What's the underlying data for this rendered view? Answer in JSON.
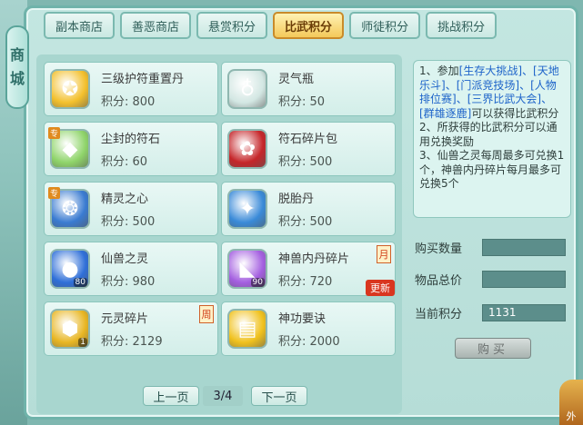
{
  "side_tab": {
    "label_1": "商",
    "label_2": "城"
  },
  "tabs": [
    {
      "label": "副本商店"
    },
    {
      "label": "善恶商店"
    },
    {
      "label": "悬赏积分"
    },
    {
      "label": "比武积分",
      "active": true
    },
    {
      "label": "师徒积分"
    },
    {
      "label": "挑战积分"
    }
  ],
  "items": [
    {
      "name": "三级护符重置丹",
      "price": "积分: 800",
      "icon": "coin-amulet-icon",
      "color": "#f3c02d"
    },
    {
      "name": "灵气瓶",
      "price": "积分: 50",
      "icon": "bottle-icon",
      "color": "#d3e7e3"
    },
    {
      "name": "尘封的符石",
      "price": "积分: 60",
      "icon": "gem-stone-icon",
      "color": "#8fd46a",
      "zhuan": "专"
    },
    {
      "name": "符石碎片包",
      "price": "积分: 500",
      "icon": "bag-icon",
      "color": "#c5262a"
    },
    {
      "name": "精灵之心",
      "price": "积分: 500",
      "icon": "spirit-heart-icon",
      "color": "#3a7bd1",
      "zhuan": "专"
    },
    {
      "name": "脱胎丹",
      "price": "积分: 500",
      "icon": "pill-icon",
      "color": "#3a8ad8"
    },
    {
      "name": "仙兽之灵",
      "price": "积分: 980",
      "icon": "orb-icon",
      "color": "#2f6fd8",
      "count": "80"
    },
    {
      "name": "神兽内丹碎片",
      "price": "积分: 720",
      "icon": "crystal-shard-icon",
      "color": "#a45fe0",
      "count": "90",
      "cycle": "月",
      "new_tag": "更新"
    },
    {
      "name": "元灵碎片",
      "price": "积分: 2129",
      "icon": "gold-fragment-icon",
      "color": "#e8b623",
      "count": "1",
      "cycle": "周"
    },
    {
      "name": "神功要诀",
      "price": "积分: 2000",
      "icon": "book-icon",
      "color": "#f0c11d"
    }
  ],
  "description": {
    "p1_prefix": "1、参加",
    "p1_links": [
      "[生存大挑战]",
      "、[天地乐斗]",
      "、[门派竞技场]",
      "、[人物排位赛]",
      "、[三界比武大会]",
      "、[群雄逐鹿]"
    ],
    "p1_suffix": "可以获得比武积分",
    "p2": "2、所获得的比武积分可以通用兑换奖励",
    "p3": "3、仙兽之灵每周最多可兑换1个，神兽内丹碎片每月最多可兑换5个"
  },
  "form": {
    "qty_label": "购买数量",
    "qty_value": "",
    "total_label": "物品总价",
    "total_value": "",
    "points_label": "当前积分",
    "points_value": "1131",
    "buy_label": "购买"
  },
  "pager": {
    "prev": "上一页",
    "indicator": "3/4",
    "next": "下一页"
  },
  "corner": {
    "label": "外"
  }
}
